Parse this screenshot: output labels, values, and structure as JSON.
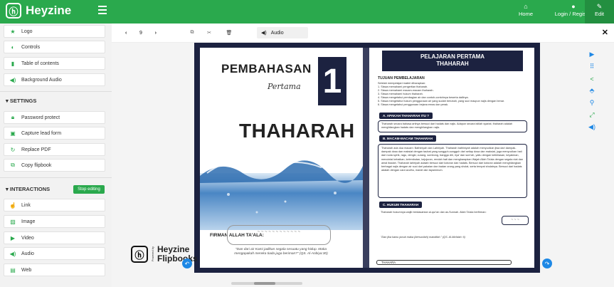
{
  "topbar": {
    "brand": "Heyzine",
    "nav": {
      "home": "Home",
      "login": "Login / Register",
      "edit": "Edit"
    }
  },
  "sidebar": {
    "items_top": [
      {
        "label": "Logo",
        "icon": "star-icon"
      },
      {
        "label": "Controls",
        "icon": "toggle-icon"
      },
      {
        "label": "Table of contents",
        "icon": "bookmark-icon"
      },
      {
        "label": "Background Audio",
        "icon": "speaker-icon"
      }
    ],
    "settings_head": "SETTINGS",
    "items_settings": [
      {
        "label": "Password protect",
        "icon": "lock-icon"
      },
      {
        "label": "Capture lead form",
        "icon": "form-icon"
      },
      {
        "label": "Replace PDF",
        "icon": "refresh-icon"
      },
      {
        "label": "Copy flipbook",
        "icon": "copy-icon"
      }
    ],
    "interactions_head": "INTERACTIONS",
    "stop_label": "Stop editing",
    "items_interactions": [
      {
        "label": "Link",
        "icon": "link-icon"
      },
      {
        "label": "Image",
        "icon": "image-icon"
      },
      {
        "label": "Video",
        "icon": "play-icon"
      },
      {
        "label": "Audio",
        "icon": "speaker-icon"
      },
      {
        "label": "Web",
        "icon": "web-icon"
      }
    ]
  },
  "toolbar": {
    "page": "9",
    "audio_label": "Audio"
  },
  "book": {
    "left": {
      "title": "PEMBAHASAN",
      "subtitle": "Pertama",
      "number": "1",
      "big": "THAHARAH",
      "firman": "FIRMAN ALLAH TA'ALA:",
      "caption": "\"Dan dari air Kami jadikan segala sesuatu yang hidup. Maka mengapakah mereka tiada juga beriman?\" (QS. Al-Anbiya:30)"
    },
    "right": {
      "header1": "PELAJARAN PERTAMA",
      "header2": "THAHARAH",
      "tujuan": "TUJUAN PEMBELAJARAN",
      "tujuan_intro": "Setelah mempelajari materi diharapkan:",
      "tujuan_list": [
        "1. Siswa memahami pengertian thaharah.",
        "2. Siswa memahami macam-macam thaharah.",
        "3. Siswa memahami hukum thaharah.",
        "4. Siswa mengetahui pembagian air dan contoh-contohnya beserta dalilnya.",
        "5. Siswa mengetahui hukum penggunaan air yang sudah berubah, yang suci maupun najis dengan benar.",
        "6. Siswa mengetahui penggunaan bejana emas dan perak."
      ],
      "sec_a": "A. APAKAH THAHARAH ITU ?",
      "sec_a_text": "Thaharah secara bahasa artinya bersuci dari hadats dan najis. Adapun secara istilah syariat, thaharah adalah menghilangkan hadats dan menghilangkan najis.",
      "sec_b": "B. MACAM-MACAM THAHARAH",
      "sec_b_text": "Thaharah ada dua macam: Bathiniyah dan Lahiriyah. Thaharah bathiniyah adalah menyucikan jiwa dari dampak-dampak dosa dan maksiat dengan taubat yang sungguh-sungguh dari setiap dosa dan maksiat, juga menyucikan hati dari noda syirik, ragu, dengki, curang, sombong, bangga diri, riya' dan sum'ah, yaitu dengan keikhlasan, keyakinan, mencintai kebaikan, kelembutan, kejujuran, rendah hati dan mengharapkan Wajah Allah Ta'ala dengan segala niat dan amal ibadah. Thaharah lahiriyah adalah bersuci dari kotoran dan hadats. Bersuci dari kotoran adalah menghilangkan berbagai najis dengan air suci dari pakaian dan badan orang yang sholat, serta tempat sholatnya. Bersuci dari hadats adalah dengan cara wudhu, mandi dan tayammum.",
      "sec_c": "C. HUKUM THAHARAH",
      "sec_c_text": "Thaharah hukumnya wajib berdasarkan al-qur'an dan as-Sunnah. Allah Ta'ala berfirman:",
      "quote": "\"Dan jika kamu junub maka (bersucilah) mandilah.\" (QS. Al-Ma'idah: 6)",
      "footer": "THAHARA"
    }
  },
  "watermark": {
    "text1": "Heyzine",
    "text2": "Flipbooks",
    "powered": "Powered by"
  },
  "colors": {
    "brand": "#2aa94d",
    "navy": "#1c2240",
    "accent": "#1e88e5"
  }
}
